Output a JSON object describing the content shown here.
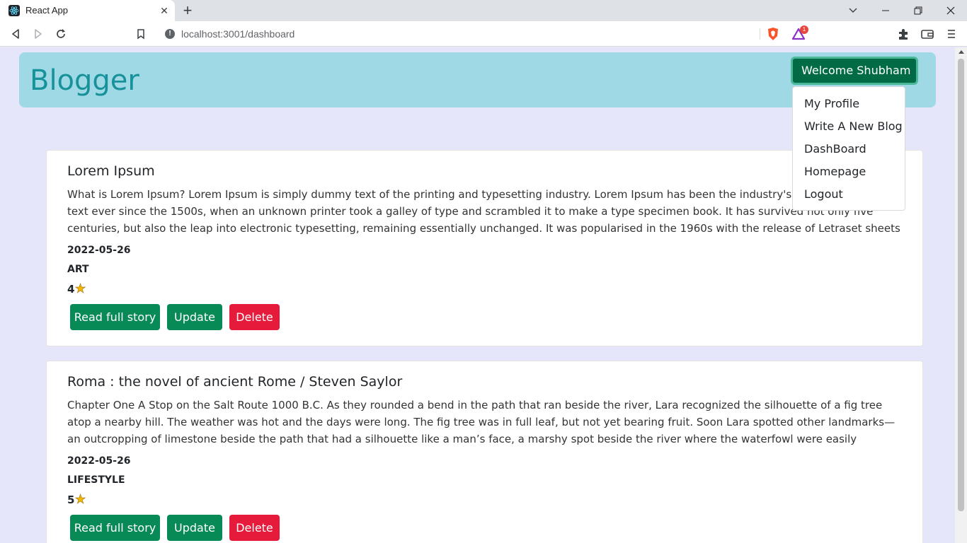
{
  "browser": {
    "tab_title": "React App",
    "tab_close": "✕",
    "new_tab": "+",
    "url": "localhost:3001/dashboard",
    "brave_badge_count": "1"
  },
  "header": {
    "brand": "Blogger",
    "welcome_label": "Welcome Shubham"
  },
  "dropdown": {
    "items": [
      "My Profile",
      "Write A New Blog",
      "DashBoard",
      "Homepage",
      "Logout"
    ]
  },
  "posts": [
    {
      "title": "Lorem Ipsum",
      "body": "What is Lorem Ipsum? Lorem Ipsum is simply dummy text of the printing and typesetting industry. Lorem Ipsum has been the industry's standard dummy text ever since the 1500s, when an unknown printer took a galley of type and scrambled it to make a type specimen book. It has survived not only five centuries, but also the leap into electronic typesetting, remaining essentially unchanged. It was popularised in the 1960s with the release of Letraset sheets containing Lorem Ipsum passages,",
      "date": "2022-05-26",
      "category": "ART",
      "rating": "4"
    },
    {
      "title": "Roma : the novel of ancient Rome / Steven Saylor",
      "body": "Chapter One A Stop on the Salt Route 1000 B.C. As they rounded a bend in the path that ran beside the river, Lara recognized the silhouette of a fig tree atop a nearby hill. The weather was hot and the days were long. The fig tree was in full leaf, but not yet bearing fruit. Soon Lara spotted other landmarks—an outcropping of limestone beside the path that had a silhouette like a man’s face, a marshy spot beside the river where the waterfowl were easily startled, a tall tree that looked like a",
      "date": "2022-05-26",
      "category": "LIFESTYLE",
      "rating": "5"
    }
  ],
  "buttons": {
    "read": "Read full story",
    "update": "Update",
    "delete": "Delete"
  },
  "star_glyph": "★"
}
